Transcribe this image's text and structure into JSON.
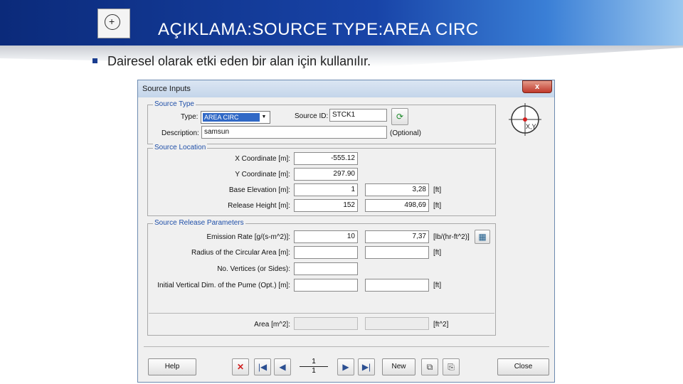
{
  "slide": {
    "title": "AÇIKLAMA:SOURCE TYPE:AREA CIRC",
    "bullet": "Dairesel olarak etki eden bir alan için kullanılır.",
    "logo_glyph": "+"
  },
  "dialog": {
    "title": "Source Inputs",
    "close_glyph": "x",
    "source_type": {
      "group_label": "Source Type",
      "type_label": "Type:",
      "type_value": "AREA CIRC",
      "source_id_label": "Source ID:",
      "source_id_value": "STCK1",
      "description_label": "Description:",
      "description_value": "samsun",
      "optional_label": "(Optional)"
    },
    "location": {
      "group_label": "Source Location",
      "x_label": "X Coordinate [m]:",
      "x_value": "-555.12",
      "y_label": "Y Coordinate [m]:",
      "y_value": "297.90",
      "base_label": "Base Elevation [m]:",
      "base_value": "1",
      "base_ft": "3,28",
      "release_label": "Release Height [m]:",
      "release_value": "152",
      "release_ft": "498,69",
      "ft_unit": "[ft]",
      "xy_label": "X,Y"
    },
    "release": {
      "group_label": "Source Release Parameters",
      "emission_label": "Emission Rate [g/(s-m^2)]:",
      "emission_value": "10",
      "emission_alt": "7,37",
      "emission_unit": "[lb/(hr-ft^2)]",
      "radius_label": "Radius of the Circular Area [m]:",
      "radius_value": "",
      "radius_unit": "[ft]",
      "vertices_label": "No. Vertices (or Sides):",
      "vertices_value": "",
      "vdim_label": "Initial Vertical Dim. of the Pume (Opt.) [m]:",
      "vdim_value": "",
      "vdim_unit": "[ft]",
      "area_label": "Area [m^2]:",
      "area_unit": "[ft^2]"
    },
    "footer": {
      "help": "Help",
      "new": "New",
      "close": "Close",
      "record_current": "1",
      "record_total": "1"
    }
  },
  "colors": {
    "header_dark": "#0b2a7a",
    "header_light": "#3a7fd6",
    "group_title": "#1f4fa8",
    "selection": "#3169c6"
  }
}
